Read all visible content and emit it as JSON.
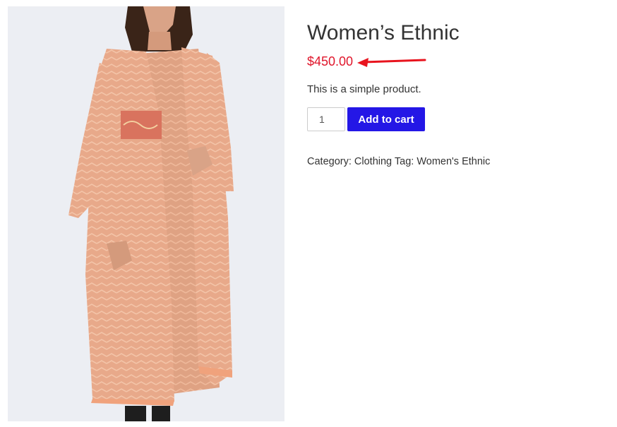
{
  "product": {
    "image_alt": "Women's Ethnic kurta product photo",
    "title": "Women’s Ethnic",
    "price": "$450.00",
    "description": "This is a simple product.",
    "quantity": "1",
    "add_to_cart_label": "Add to cart",
    "category_label": "Category:",
    "category": "Clothing",
    "tag_label": "Tag:",
    "tag": "Women's Ethnic"
  },
  "colors": {
    "price": "#e0162b",
    "button": "#2417e6",
    "annotation_arrow": "#e8141e"
  }
}
